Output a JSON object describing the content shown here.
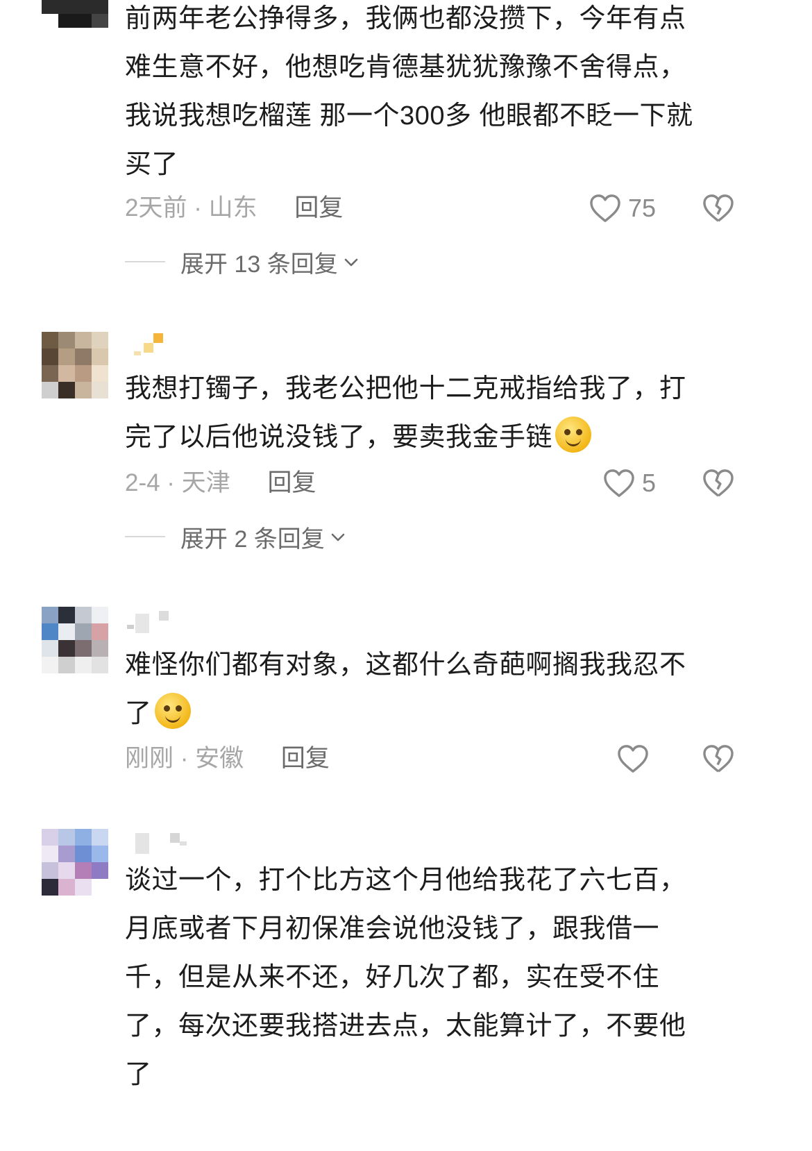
{
  "comments": [
    {
      "text_lines": [
        "前两年老公挣得多，我俩也都没攒下，今年有点",
        "难生意不好，他想吃肯德基犹犹豫豫不舍得点，",
        "我说我想吃榴莲 那一个300多 他眼都不眨一下就",
        "买了"
      ],
      "time": "2天前 · 山东",
      "reply_label": "回复",
      "likes": "75",
      "expand_label": "展开 13 条回复"
    },
    {
      "text_lines": [
        "我想打镯子，我老公把他十二克戒指给我了，打",
        "完了以后他说没钱了，要卖我金手链"
      ],
      "time": "2-4 · 天津",
      "reply_label": "回复",
      "likes": "5",
      "expand_label": "展开 2 条回复"
    },
    {
      "text_lines": [
        "难怪你们都有对象，这都什么奇葩啊搁我我忍不",
        "了"
      ],
      "time": "刚刚 · 安徽",
      "reply_label": "回复",
      "likes": ""
    },
    {
      "text_lines": [
        "谈过一个，打个比方这个月他给我花了六七百，",
        "月底或者下月初保准会说他没钱了，跟我借一",
        "千，但是从来不还，好几次了都，实在受不住",
        "了，每次还要我搭进去点，太能算计了，不要他",
        "了"
      ]
    }
  ],
  "icons": {
    "like": "heart-outline-icon",
    "dislike": "broken-heart-icon",
    "expand": "chevron-down-icon",
    "emoji_dizzy": "dizzy-face-emoji",
    "emoji_pleading": "pleading-face-emoji"
  },
  "colors": {
    "text": "#1c1c1c",
    "meta": "#a6a6a6",
    "action": "#6b6b6b",
    "icon": "#8a8a8a"
  }
}
